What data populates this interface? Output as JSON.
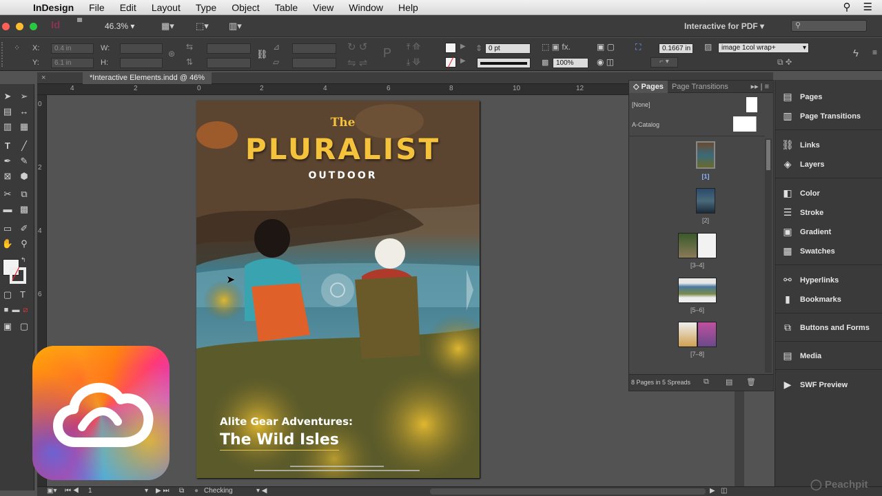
{
  "menubar": {
    "app": "InDesign",
    "items": [
      "File",
      "Edit",
      "Layout",
      "Type",
      "Object",
      "Table",
      "View",
      "Window",
      "Help"
    ]
  },
  "appbar": {
    "app_icon": "Id",
    "zoom": "46.3%",
    "workspace": "Interactive for PDF",
    "search_placeholder": ""
  },
  "control": {
    "x_label": "X:",
    "x_value": "0.4 in",
    "y_label": "Y:",
    "y_value": "6.1 in",
    "w_label": "W:",
    "h_label": "H:",
    "stroke_weight": "0 pt",
    "opacity": "100%",
    "offset": "0.1667 in",
    "object_style": "image 1col wrap+"
  },
  "document": {
    "tab": "*Interactive Elements.indd @ 46%",
    "ruler_h": [
      "4",
      "2",
      "0",
      "2",
      "4",
      "6",
      "8",
      "10",
      "12"
    ],
    "ruler_v": [
      "0",
      "2",
      "4",
      "6"
    ]
  },
  "cover": {
    "the": "The",
    "title": "PLURALIST",
    "subtitle": "OUTDOOR",
    "kicker": "Alite Gear Adventures:",
    "headline": "The Wild Isles"
  },
  "pages_panel": {
    "tab_pages": "Pages",
    "tab_transitions": "Page Transitions",
    "none_master": "[None]",
    "a_master": "A-Catalog",
    "spreads": [
      {
        "label": "[1]"
      },
      {
        "label": "[2]"
      },
      {
        "label": "[3–4]"
      },
      {
        "label": "[5–6]"
      },
      {
        "label": "[7–8]"
      }
    ],
    "footer": "8 Pages in 5 Spreads"
  },
  "dock": {
    "items": [
      {
        "label": "Pages",
        "icon": "pages-icon"
      },
      {
        "label": "Page Transitions",
        "icon": "page-transitions-icon"
      },
      {
        "label": "Links",
        "icon": "links-icon"
      },
      {
        "label": "Layers",
        "icon": "layers-icon"
      },
      {
        "label": "Color",
        "icon": "color-icon"
      },
      {
        "label": "Stroke",
        "icon": "stroke-icon"
      },
      {
        "label": "Gradient",
        "icon": "gradient-icon"
      },
      {
        "label": "Swatches",
        "icon": "swatches-icon"
      },
      {
        "label": "Hyperlinks",
        "icon": "hyperlinks-icon"
      },
      {
        "label": "Bookmarks",
        "icon": "bookmarks-icon"
      },
      {
        "label": "Buttons and Forms",
        "icon": "buttons-forms-icon"
      },
      {
        "label": "Media",
        "icon": "media-icon"
      },
      {
        "label": "SWF Preview",
        "icon": "swf-preview-icon"
      }
    ]
  },
  "status": {
    "page": "1",
    "preflight": "Checking"
  },
  "watermark": "Peachpit"
}
